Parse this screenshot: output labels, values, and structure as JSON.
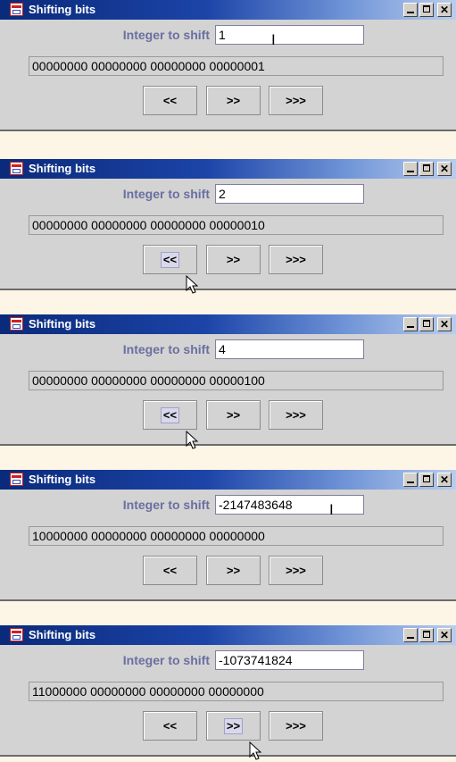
{
  "windows": [
    {
      "title": "Shifting bits",
      "label": "Integer to shift",
      "input_value": "1",
      "output": "00000000 00000000 00000000 00000001",
      "buttons": [
        "<<",
        ">>",
        ">>>"
      ],
      "pressed": null,
      "ibeam": true,
      "ibeam_char": "I"
    },
    {
      "title": "Shifting bits",
      "label": "Integer to shift",
      "input_value": "2",
      "output": "00000000 00000000 00000000 00000010",
      "buttons": [
        "<<",
        ">>",
        ">>>"
      ],
      "pressed": 0,
      "ibeam": false
    },
    {
      "title": "Shifting bits",
      "label": "Integer to shift",
      "input_value": "4",
      "output": "00000000 00000000 00000000 00000100",
      "buttons": [
        "<<",
        ">>",
        ">>>"
      ],
      "pressed": 0,
      "ibeam": false
    },
    {
      "title": "Shifting bits",
      "label": "Integer to shift",
      "input_value": "-2147483648",
      "output": "10000000 00000000 00000000 00000000",
      "buttons": [
        "<<",
        ">>",
        ">>>"
      ],
      "pressed": null,
      "ibeam": true,
      "ibeam_char": "I"
    },
    {
      "title": "Shifting bits",
      "label": "Integer to shift",
      "input_value": "-1073741824",
      "output": "11000000 00000000 00000000 00000000",
      "buttons": [
        "<<",
        ">>",
        ">>>"
      ],
      "pressed": 1,
      "ibeam": false
    }
  ],
  "colors": {
    "window_bg": "#d3d3d3",
    "page_bg": "#fdf5e6",
    "title_gradient_start": "#0a2a7a",
    "label_color": "#6a6fa0"
  },
  "icons": {
    "app": "java-app-icon",
    "minimize": "minimize-icon",
    "maximize": "maximize-icon",
    "close": "close-icon",
    "cursor": "arrow-cursor-icon",
    "text_cursor": "ibeam-cursor-icon"
  }
}
